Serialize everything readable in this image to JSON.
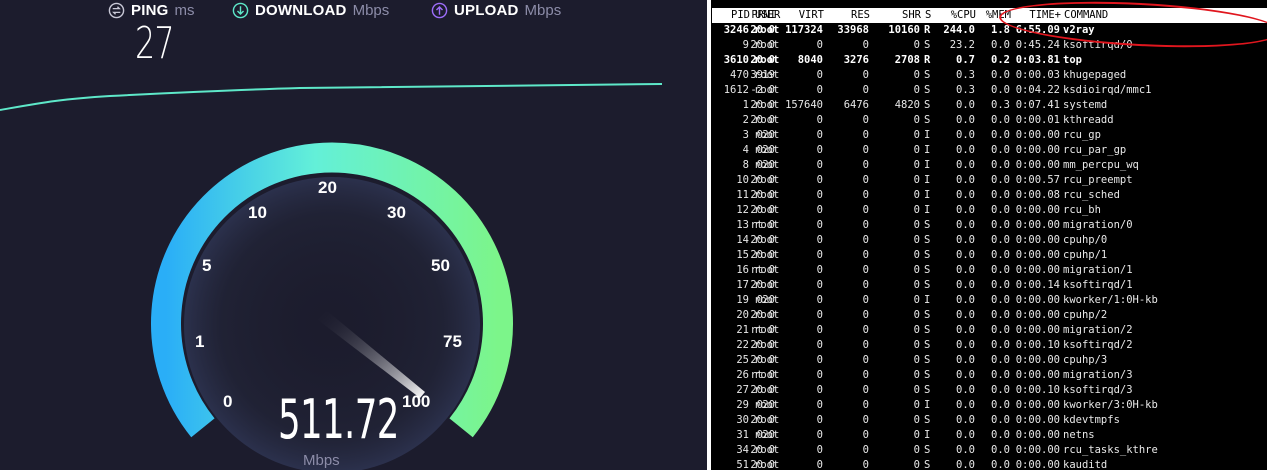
{
  "speedtest": {
    "ping": {
      "label": "PING",
      "unit": "ms",
      "value": "27"
    },
    "download": {
      "label": "DOWNLOAD",
      "unit": "Mbps"
    },
    "upload": {
      "label": "UPLOAD",
      "unit": "Mbps"
    },
    "gauge_ticks": [
      "0",
      "1",
      "5",
      "10",
      "20",
      "30",
      "50",
      "75",
      "100"
    ],
    "speed_value": "511.72",
    "speed_unit": "Mbps",
    "accent_download": "#5ee8c9",
    "accent_upload": "#9d6dfa"
  },
  "top": {
    "columns": [
      "PID",
      "USER",
      "PR",
      "NI",
      "VIRT",
      "RES",
      "SHR",
      "S",
      "%CPU",
      "%MEM",
      "TIME+",
      "COMMAND"
    ],
    "rows": [
      {
        "pid": "3246",
        "user": "root",
        "pr": "20",
        "ni": "0",
        "virt": "117324",
        "res": "33968",
        "shr": "10160",
        "s": "R",
        "cpu": "244.0",
        "mem": "1.8",
        "time": "6:55.09",
        "cmd": "v2ray",
        "bold": true
      },
      {
        "pid": "9",
        "user": "root",
        "pr": "20",
        "ni": "0",
        "virt": "0",
        "res": "0",
        "shr": "0",
        "s": "S",
        "cpu": "23.2",
        "mem": "0.0",
        "time": "0:45.24",
        "cmd": "ksoftirqd/0",
        "bold": false
      },
      {
        "pid": "3610",
        "user": "root",
        "pr": "20",
        "ni": "0",
        "virt": "8040",
        "res": "3276",
        "shr": "2708",
        "s": "R",
        "cpu": "0.7",
        "mem": "0.2",
        "time": "0:03.81",
        "cmd": "top",
        "bold": true
      },
      {
        "pid": "470",
        "user": "root",
        "pr": "39",
        "ni": "19",
        "virt": "0",
        "res": "0",
        "shr": "0",
        "s": "S",
        "cpu": "0.3",
        "mem": "0.0",
        "time": "0:00.03",
        "cmd": "khugepaged",
        "bold": false
      },
      {
        "pid": "1612",
        "user": "root",
        "pr": "-2",
        "ni": "0",
        "virt": "0",
        "res": "0",
        "shr": "0",
        "s": "S",
        "cpu": "0.3",
        "mem": "0.0",
        "time": "0:04.22",
        "cmd": "ksdioirqd/mmc1",
        "bold": false
      },
      {
        "pid": "1",
        "user": "root",
        "pr": "20",
        "ni": "0",
        "virt": "157640",
        "res": "6476",
        "shr": "4820",
        "s": "S",
        "cpu": "0.0",
        "mem": "0.3",
        "time": "0:07.41",
        "cmd": "systemd",
        "bold": false
      },
      {
        "pid": "2",
        "user": "root",
        "pr": "20",
        "ni": "0",
        "virt": "0",
        "res": "0",
        "shr": "0",
        "s": "S",
        "cpu": "0.0",
        "mem": "0.0",
        "time": "0:00.01",
        "cmd": "kthreadd",
        "bold": false
      },
      {
        "pid": "3",
        "user": "root",
        "pr": "0",
        "ni": "-20",
        "virt": "0",
        "res": "0",
        "shr": "0",
        "s": "I",
        "cpu": "0.0",
        "mem": "0.0",
        "time": "0:00.00",
        "cmd": "rcu_gp",
        "bold": false
      },
      {
        "pid": "4",
        "user": "root",
        "pr": "0",
        "ni": "-20",
        "virt": "0",
        "res": "0",
        "shr": "0",
        "s": "I",
        "cpu": "0.0",
        "mem": "0.0",
        "time": "0:00.00",
        "cmd": "rcu_par_gp",
        "bold": false
      },
      {
        "pid": "8",
        "user": "root",
        "pr": "0",
        "ni": "-20",
        "virt": "0",
        "res": "0",
        "shr": "0",
        "s": "I",
        "cpu": "0.0",
        "mem": "0.0",
        "time": "0:00.00",
        "cmd": "mm_percpu_wq",
        "bold": false
      },
      {
        "pid": "10",
        "user": "root",
        "pr": "20",
        "ni": "0",
        "virt": "0",
        "res": "0",
        "shr": "0",
        "s": "I",
        "cpu": "0.0",
        "mem": "0.0",
        "time": "0:00.57",
        "cmd": "rcu_preempt",
        "bold": false
      },
      {
        "pid": "11",
        "user": "root",
        "pr": "20",
        "ni": "0",
        "virt": "0",
        "res": "0",
        "shr": "0",
        "s": "I",
        "cpu": "0.0",
        "mem": "0.0",
        "time": "0:00.08",
        "cmd": "rcu_sched",
        "bold": false
      },
      {
        "pid": "12",
        "user": "root",
        "pr": "20",
        "ni": "0",
        "virt": "0",
        "res": "0",
        "shr": "0",
        "s": "I",
        "cpu": "0.0",
        "mem": "0.0",
        "time": "0:00.00",
        "cmd": "rcu_bh",
        "bold": false
      },
      {
        "pid": "13",
        "user": "root",
        "pr": "rt",
        "ni": "0",
        "virt": "0",
        "res": "0",
        "shr": "0",
        "s": "S",
        "cpu": "0.0",
        "mem": "0.0",
        "time": "0:00.00",
        "cmd": "migration/0",
        "bold": false
      },
      {
        "pid": "14",
        "user": "root",
        "pr": "20",
        "ni": "0",
        "virt": "0",
        "res": "0",
        "shr": "0",
        "s": "S",
        "cpu": "0.0",
        "mem": "0.0",
        "time": "0:00.00",
        "cmd": "cpuhp/0",
        "bold": false
      },
      {
        "pid": "15",
        "user": "root",
        "pr": "20",
        "ni": "0",
        "virt": "0",
        "res": "0",
        "shr": "0",
        "s": "S",
        "cpu": "0.0",
        "mem": "0.0",
        "time": "0:00.00",
        "cmd": "cpuhp/1",
        "bold": false
      },
      {
        "pid": "16",
        "user": "root",
        "pr": "rt",
        "ni": "0",
        "virt": "0",
        "res": "0",
        "shr": "0",
        "s": "S",
        "cpu": "0.0",
        "mem": "0.0",
        "time": "0:00.00",
        "cmd": "migration/1",
        "bold": false
      },
      {
        "pid": "17",
        "user": "root",
        "pr": "20",
        "ni": "0",
        "virt": "0",
        "res": "0",
        "shr": "0",
        "s": "S",
        "cpu": "0.0",
        "mem": "0.0",
        "time": "0:00.14",
        "cmd": "ksoftirqd/1",
        "bold": false
      },
      {
        "pid": "19",
        "user": "root",
        "pr": "0",
        "ni": "-20",
        "virt": "0",
        "res": "0",
        "shr": "0",
        "s": "I",
        "cpu": "0.0",
        "mem": "0.0",
        "time": "0:00.00",
        "cmd": "kworker/1:0H-kb",
        "bold": false
      },
      {
        "pid": "20",
        "user": "root",
        "pr": "20",
        "ni": "0",
        "virt": "0",
        "res": "0",
        "shr": "0",
        "s": "S",
        "cpu": "0.0",
        "mem": "0.0",
        "time": "0:00.00",
        "cmd": "cpuhp/2",
        "bold": false
      },
      {
        "pid": "21",
        "user": "root",
        "pr": "rt",
        "ni": "0",
        "virt": "0",
        "res": "0",
        "shr": "0",
        "s": "S",
        "cpu": "0.0",
        "mem": "0.0",
        "time": "0:00.00",
        "cmd": "migration/2",
        "bold": false
      },
      {
        "pid": "22",
        "user": "root",
        "pr": "20",
        "ni": "0",
        "virt": "0",
        "res": "0",
        "shr": "0",
        "s": "S",
        "cpu": "0.0",
        "mem": "0.0",
        "time": "0:00.10",
        "cmd": "ksoftirqd/2",
        "bold": false
      },
      {
        "pid": "25",
        "user": "root",
        "pr": "20",
        "ni": "0",
        "virt": "0",
        "res": "0",
        "shr": "0",
        "s": "S",
        "cpu": "0.0",
        "mem": "0.0",
        "time": "0:00.00",
        "cmd": "cpuhp/3",
        "bold": false
      },
      {
        "pid": "26",
        "user": "root",
        "pr": "rt",
        "ni": "0",
        "virt": "0",
        "res": "0",
        "shr": "0",
        "s": "S",
        "cpu": "0.0",
        "mem": "0.0",
        "time": "0:00.00",
        "cmd": "migration/3",
        "bold": false
      },
      {
        "pid": "27",
        "user": "root",
        "pr": "20",
        "ni": "0",
        "virt": "0",
        "res": "0",
        "shr": "0",
        "s": "S",
        "cpu": "0.0",
        "mem": "0.0",
        "time": "0:00.10",
        "cmd": "ksoftirqd/3",
        "bold": false
      },
      {
        "pid": "29",
        "user": "root",
        "pr": "0",
        "ni": "-20",
        "virt": "0",
        "res": "0",
        "shr": "0",
        "s": "I",
        "cpu": "0.0",
        "mem": "0.0",
        "time": "0:00.00",
        "cmd": "kworker/3:0H-kb",
        "bold": false
      },
      {
        "pid": "30",
        "user": "root",
        "pr": "20",
        "ni": "0",
        "virt": "0",
        "res": "0",
        "shr": "0",
        "s": "S",
        "cpu": "0.0",
        "mem": "0.0",
        "time": "0:00.00",
        "cmd": "kdevtmpfs",
        "bold": false
      },
      {
        "pid": "31",
        "user": "root",
        "pr": "0",
        "ni": "-20",
        "virt": "0",
        "res": "0",
        "shr": "0",
        "s": "I",
        "cpu": "0.0",
        "mem": "0.0",
        "time": "0:00.00",
        "cmd": "netns",
        "bold": false
      },
      {
        "pid": "34",
        "user": "root",
        "pr": "20",
        "ni": "0",
        "virt": "0",
        "res": "0",
        "shr": "0",
        "s": "S",
        "cpu": "0.0",
        "mem": "0.0",
        "time": "0:00.00",
        "cmd": "rcu_tasks_kthre",
        "bold": false
      },
      {
        "pid": "51",
        "user": "root",
        "pr": "20",
        "ni": "0",
        "virt": "0",
        "res": "0",
        "shr": "0",
        "s": "S",
        "cpu": "0.0",
        "mem": "0.0",
        "time": "0:00.00",
        "cmd": "kauditd",
        "bold": false
      }
    ]
  }
}
